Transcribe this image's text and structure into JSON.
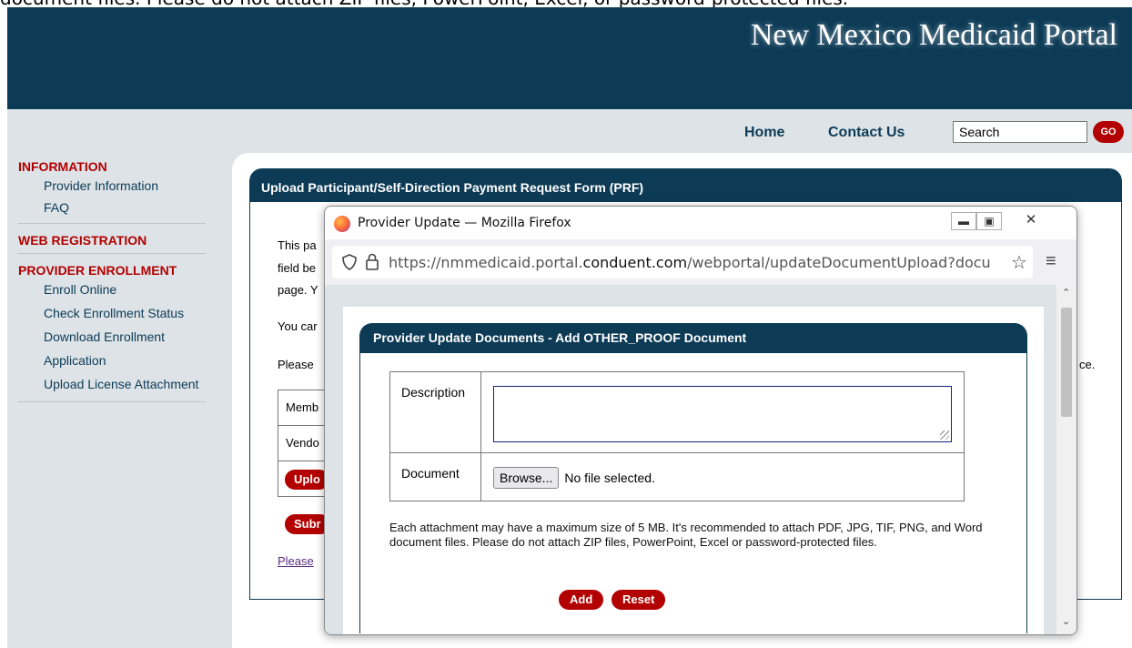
{
  "clipped_text": "document files. Please do not attach ZIP files, PowerPoint, Excel, or password-protected files.",
  "header": {
    "title": "New Mexico Medicaid Portal"
  },
  "topnav": {
    "home": "Home",
    "contact": "Contact Us",
    "search_value": "Search",
    "go": "GO"
  },
  "sidebar": {
    "sections": [
      {
        "heading": "INFORMATION",
        "items": [
          "Provider Information",
          "FAQ"
        ]
      },
      {
        "heading": "WEB REGISTRATION",
        "items": []
      },
      {
        "heading": "PROVIDER ENROLLMENT",
        "items": [
          "Enroll Online",
          "Check Enrollment Status",
          "Download Enrollment",
          "Application",
          "Upload License Attachment"
        ]
      }
    ]
  },
  "main": {
    "panel_title": "Upload Participant/Self-Direction Payment Request Form (PRF)",
    "text_fragments": [
      "This pa",
      "field be",
      "page. Y",
      "You car",
      "Please",
      "ce."
    ],
    "table_rows": [
      "Memb",
      "Vendo"
    ],
    "upload_btn": "Uplo",
    "submit_btn": "Subr",
    "link": "Please"
  },
  "popup": {
    "window_title": "Provider Update — Mozilla Firefox",
    "url_prefix": "https://nmmedicaid.portal.",
    "url_domain": "conduent.com",
    "url_suffix": "/webportal/updateDocumentUpload?docu",
    "panel_title": "Provider Update Documents - Add OTHER_PROOF Document",
    "description_label": "Description",
    "document_label": "Document",
    "browse_label": "Browse...",
    "no_file": "No file selected.",
    "help": "Each attachment may have a maximum size of 5 MB. It's recommended to attach PDF, JPG, TIF, PNG, and Word document files. Please do not attach ZIP files, PowerPoint, Excel or password-protected files.",
    "add": "Add",
    "reset": "Reset"
  }
}
